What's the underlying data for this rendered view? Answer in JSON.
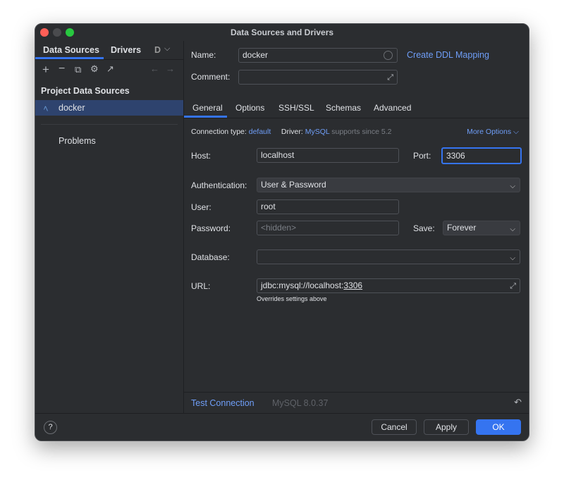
{
  "window": {
    "title": "Data Sources and Drivers"
  },
  "left": {
    "tabs": [
      {
        "label": "Data Sources"
      },
      {
        "label": "Drivers"
      },
      {
        "label": "D"
      }
    ],
    "section_title": "Project Data Sources",
    "items": [
      {
        "label": "docker",
        "icon": "mysql-dolphin-icon"
      }
    ],
    "problems": "Problems"
  },
  "form": {
    "name_label": "Name:",
    "name_value": "docker",
    "create_ddl": "Create DDL Mapping",
    "comment_label": "Comment:",
    "comment_value": "",
    "tabs": [
      {
        "label": "General"
      },
      {
        "label": "Options"
      },
      {
        "label": "SSH/SSL"
      },
      {
        "label": "Schemas"
      },
      {
        "label": "Advanced"
      }
    ],
    "conn_type_label": "Connection type:",
    "conn_type_value": "default",
    "driver_label": "Driver:",
    "driver_value": "MySQL",
    "driver_note": "supports since 5.2",
    "more_options": "More Options",
    "host_label": "Host:",
    "host_value": "localhost",
    "port_label": "Port:",
    "port_value": "3306",
    "auth_label": "Authentication:",
    "auth_value": "User & Password",
    "user_label": "User:",
    "user_value": "root",
    "password_label": "Password:",
    "password_placeholder": "<hidden>",
    "save_label": "Save:",
    "save_value": "Forever",
    "database_label": "Database:",
    "database_value": "",
    "url_label": "URL:",
    "url_prefix": "jdbc:mysql://localhost:",
    "url_port": "3306",
    "url_note": "Overrides settings above"
  },
  "status": {
    "test_connection": "Test Connection",
    "version": "MySQL 8.0.37"
  },
  "footer": {
    "help": "?",
    "cancel": "Cancel",
    "apply": "Apply",
    "ok": "OK"
  },
  "colors": {
    "accent": "#3574f0",
    "link": "#6f9ef8",
    "selection": "#2e436e"
  }
}
